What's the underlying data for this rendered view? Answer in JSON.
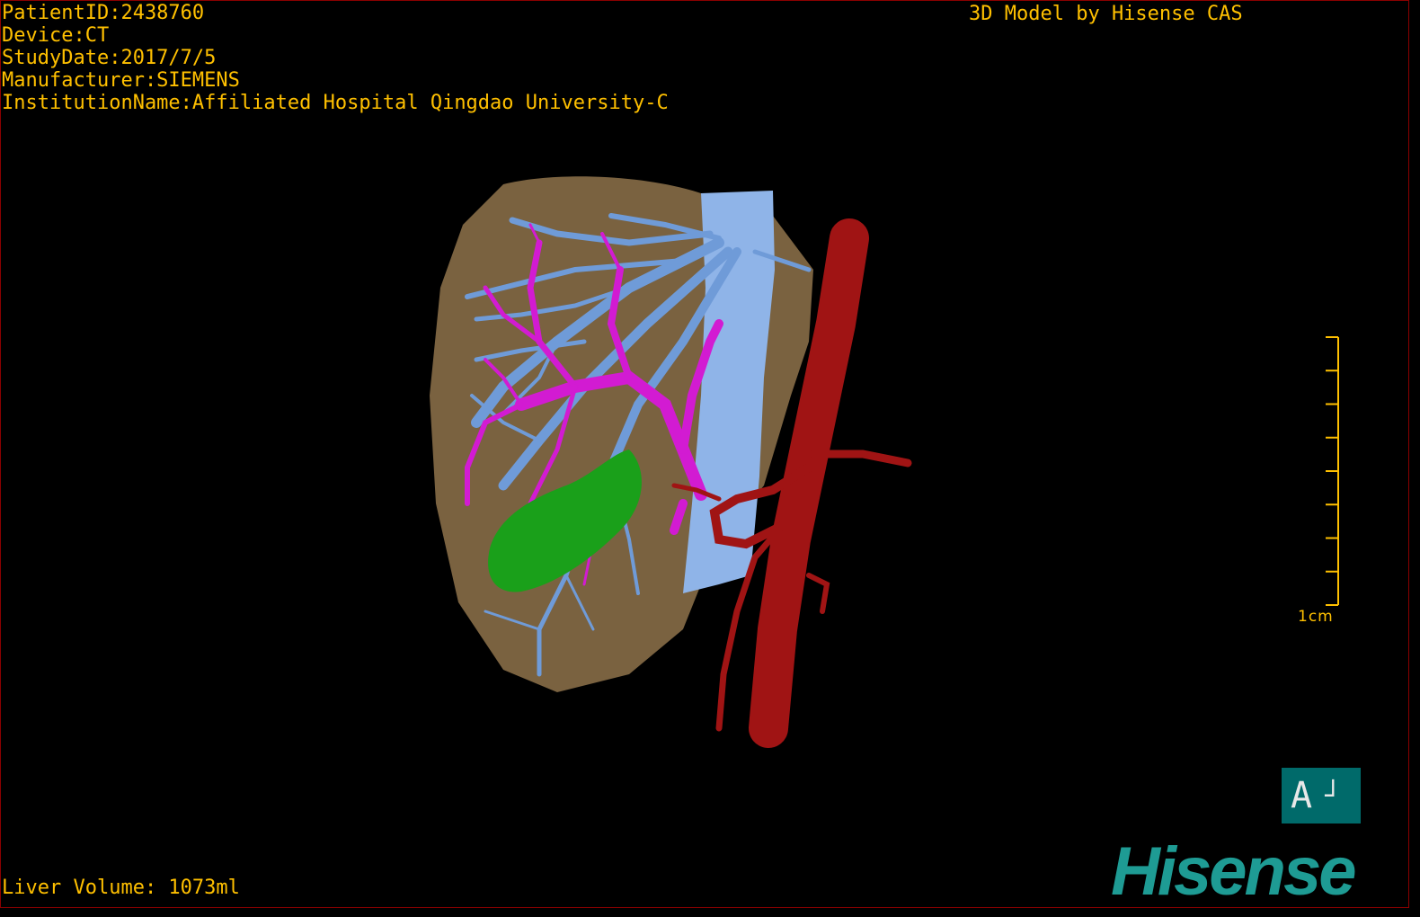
{
  "patient_info": {
    "patient_id": "PatientID:2438760",
    "device": "Device:CT",
    "study_date": "StudyDate:2017/7/5",
    "manufacturer": "Manufacturer:SIEMENS",
    "institution": "InstitutionName:Affiliated Hospital Qingdao University-C"
  },
  "credit": "3D Model by Hisense CAS",
  "liver_volume": "Liver Volume: 1073ml",
  "scale": {
    "label": "1cm",
    "tick_count": 8
  },
  "orientation": {
    "letter": "A",
    "marker": "┘"
  },
  "logo": "Hisense",
  "colors": {
    "text": "#ffc000",
    "liver": "#7a6240",
    "hepatic_vein": "#6f9bd8",
    "portal_vein": "#d21bd2",
    "gallbladder": "#1aa01a",
    "artery": "#a01414",
    "ivc": "#8fb4e8",
    "orientation_bg": "#006a6a",
    "logo": "#1e9b94"
  }
}
